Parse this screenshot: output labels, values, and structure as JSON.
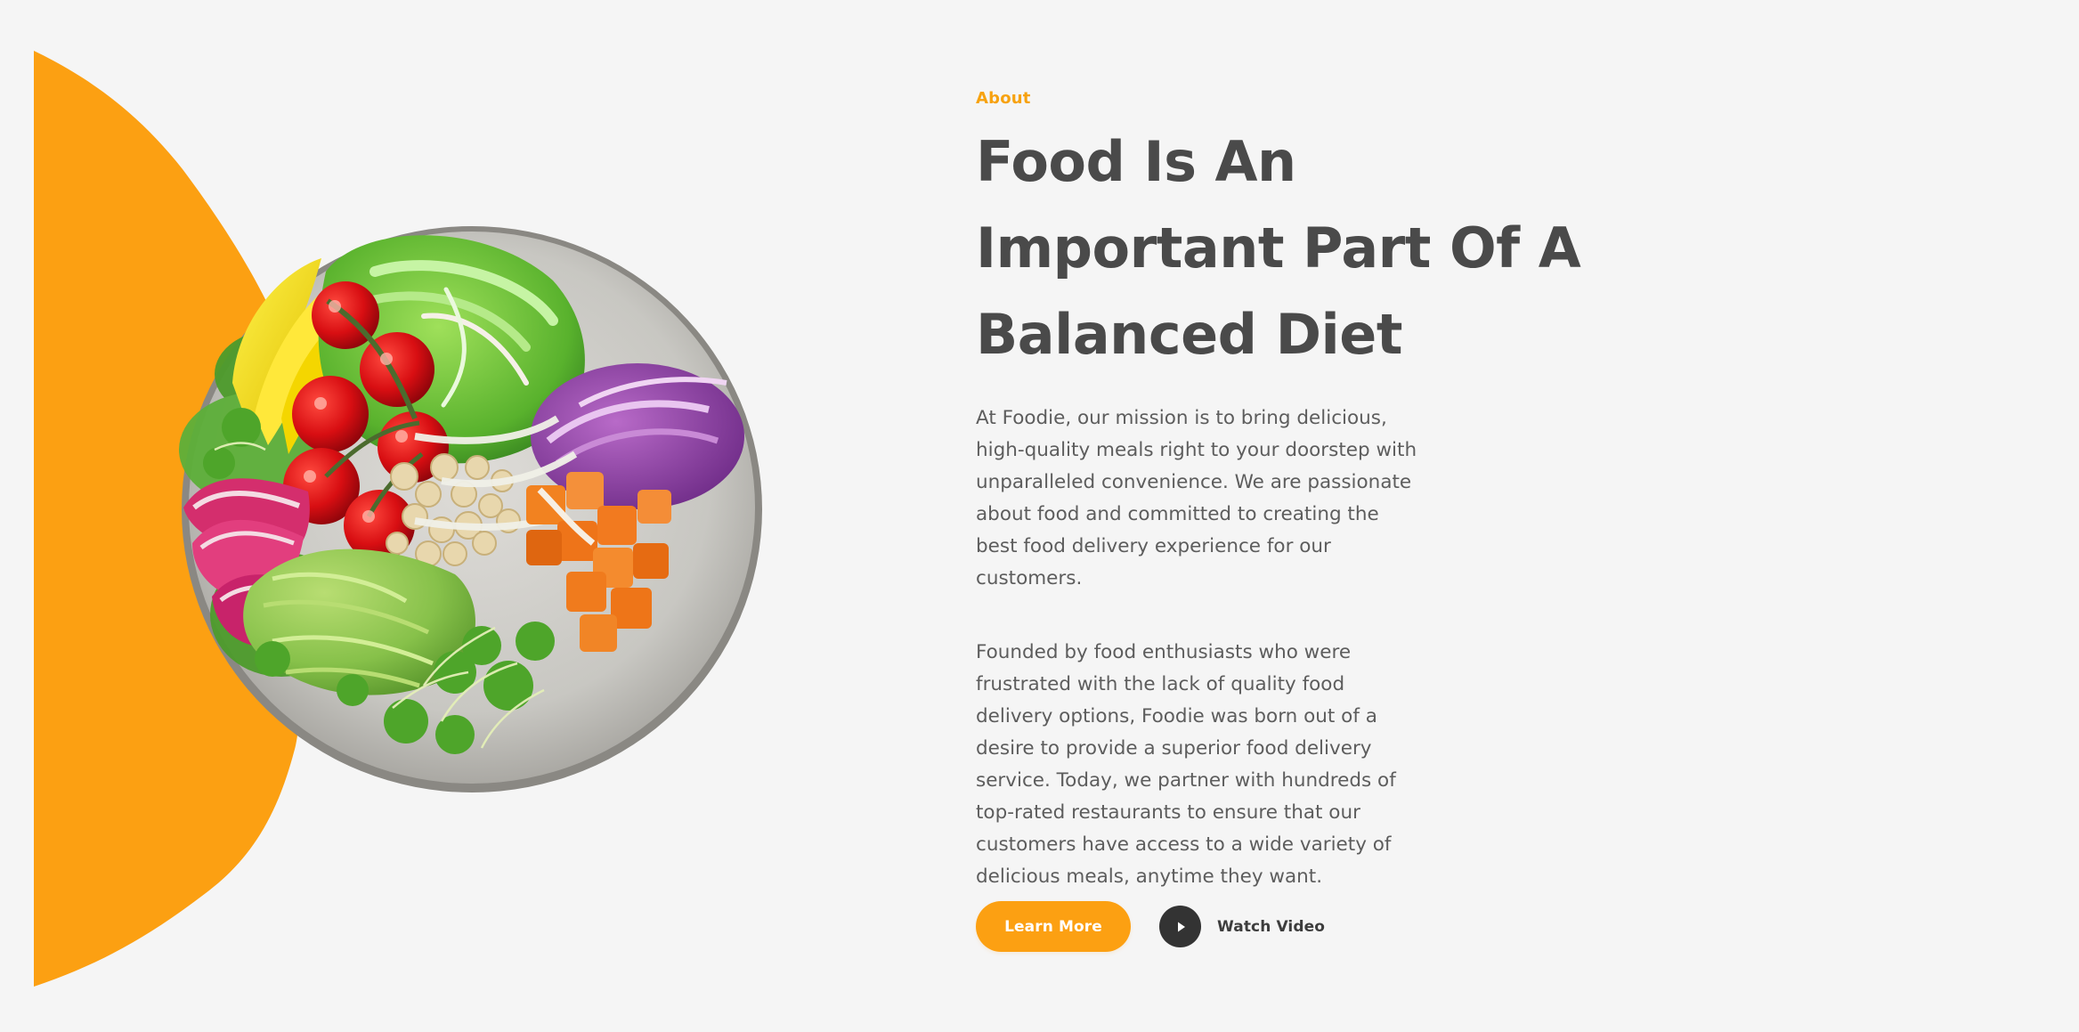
{
  "about": {
    "eyebrow": "About",
    "title_lines": [
      "Food Is An",
      "Important Part Of A",
      "Balanced Diet"
    ],
    "paragraph_1": "At Foodie, our mission is to bring delicious, high-quality meals right to your doorstep with unparalleled convenience. We are passionate about food and committed to creating the best food delivery experience for our customers.",
    "paragraph_2": "Founded by food enthusiasts who were frustrated with the lack of quality food delivery options, Foodie was born out of a desire to provide a superior food delivery service. Today, we partner with hundreds of top-rated restaurants to ensure that our customers have access to a wide variety of delicious meals, anytime they want."
  },
  "actions": {
    "learn_more": "Learn More",
    "watch_video": "Watch Video",
    "play_icon": "play-icon"
  },
  "visuals": {
    "blob_icon": "orange-blob",
    "bowl_icon": "salad-bowl-illustration"
  },
  "colors": {
    "accent": "#fca012",
    "heading": "#4a4a4a",
    "body": "#5d5d5d",
    "background": "#f5f5f5",
    "play_button": "#333333"
  }
}
